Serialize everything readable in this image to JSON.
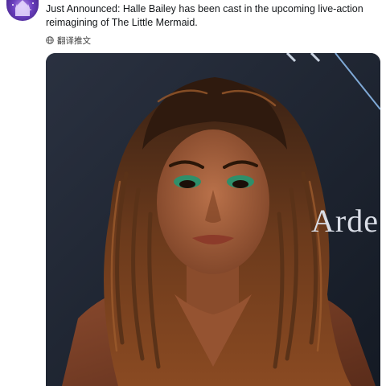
{
  "tweet": {
    "avatar_icon": "disney-castle-avatar",
    "text": "Just Announced: Halle Bailey has been cast in the upcoming live-action reimagining of The Little Mermaid.",
    "translate": {
      "icon": "globe-icon",
      "label": "翻译推文"
    },
    "media": {
      "backdrop_text": "Arde",
      "accent_color": "#1b6ec2"
    }
  }
}
